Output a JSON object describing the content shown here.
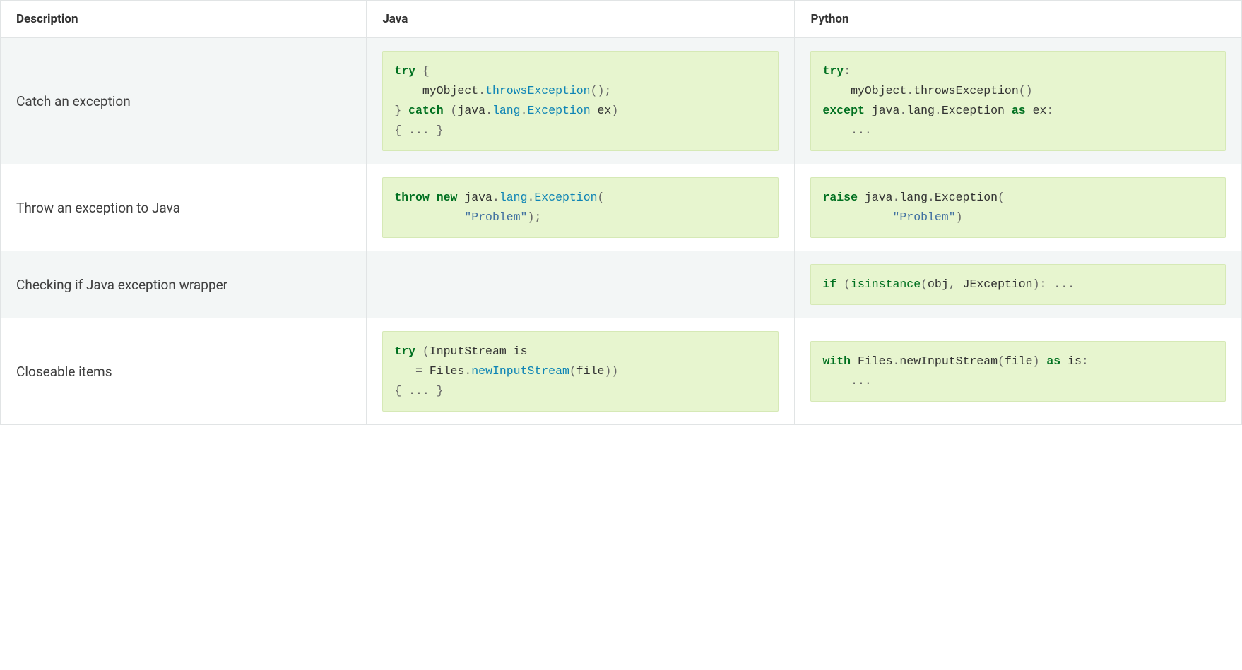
{
  "headers": {
    "description": "Description",
    "java": "Java",
    "python": "Python"
  },
  "rows": [
    {
      "desc": "Catch an exception",
      "java": [
        {
          "cls": "k",
          "t": "try"
        },
        {
          "cls": "p",
          "t": " {\n"
        },
        {
          "cls": "",
          "t": "    myObject"
        },
        {
          "cls": "p",
          "t": "."
        },
        {
          "cls": "nm",
          "t": "throwsException"
        },
        {
          "cls": "p",
          "t": "();\n"
        },
        {
          "cls": "p",
          "t": "} "
        },
        {
          "cls": "k",
          "t": "catch"
        },
        {
          "cls": "p",
          "t": " ("
        },
        {
          "cls": "",
          "t": "java"
        },
        {
          "cls": "p",
          "t": "."
        },
        {
          "cls": "nm",
          "t": "lang"
        },
        {
          "cls": "p",
          "t": "."
        },
        {
          "cls": "nm",
          "t": "Exception"
        },
        {
          "cls": "",
          "t": " ex"
        },
        {
          "cls": "p",
          "t": ")\n"
        },
        {
          "cls": "p",
          "t": "{ ... }"
        }
      ],
      "python": [
        {
          "cls": "k",
          "t": "try"
        },
        {
          "cls": "p",
          "t": ":\n"
        },
        {
          "cls": "",
          "t": "    myObject"
        },
        {
          "cls": "p",
          "t": "."
        },
        {
          "cls": "",
          "t": "throwsException"
        },
        {
          "cls": "p",
          "t": "()\n"
        },
        {
          "cls": "k",
          "t": "except"
        },
        {
          "cls": "",
          "t": " java"
        },
        {
          "cls": "p",
          "t": "."
        },
        {
          "cls": "",
          "t": "lang"
        },
        {
          "cls": "p",
          "t": "."
        },
        {
          "cls": "",
          "t": "Exception "
        },
        {
          "cls": "k",
          "t": "as"
        },
        {
          "cls": "",
          "t": " ex"
        },
        {
          "cls": "p",
          "t": ":\n"
        },
        {
          "cls": "p",
          "t": "    ..."
        }
      ]
    },
    {
      "desc": "Throw an exception to Java",
      "java": [
        {
          "cls": "k",
          "t": "throw"
        },
        {
          "cls": "",
          "t": " "
        },
        {
          "cls": "k",
          "t": "new"
        },
        {
          "cls": "",
          "t": " java"
        },
        {
          "cls": "p",
          "t": "."
        },
        {
          "cls": "nm",
          "t": "lang"
        },
        {
          "cls": "p",
          "t": "."
        },
        {
          "cls": "nm",
          "t": "Exception"
        },
        {
          "cls": "p",
          "t": "(\n"
        },
        {
          "cls": "",
          "t": "          "
        },
        {
          "cls": "s",
          "t": "\"Problem\""
        },
        {
          "cls": "p",
          "t": ");"
        }
      ],
      "python": [
        {
          "cls": "k",
          "t": "raise"
        },
        {
          "cls": "",
          "t": " java"
        },
        {
          "cls": "p",
          "t": "."
        },
        {
          "cls": "",
          "t": "lang"
        },
        {
          "cls": "p",
          "t": "."
        },
        {
          "cls": "",
          "t": "Exception"
        },
        {
          "cls": "p",
          "t": "(\n"
        },
        {
          "cls": "",
          "t": "          "
        },
        {
          "cls": "s",
          "t": "\"Problem\""
        },
        {
          "cls": "p",
          "t": ")"
        }
      ]
    },
    {
      "desc": "Checking if Java exception wrapper",
      "java": null,
      "python": [
        {
          "cls": "k",
          "t": "if"
        },
        {
          "cls": "p",
          "t": " ("
        },
        {
          "cls": "nb",
          "t": "isinstance"
        },
        {
          "cls": "p",
          "t": "("
        },
        {
          "cls": "",
          "t": "obj"
        },
        {
          "cls": "p",
          "t": ", "
        },
        {
          "cls": "",
          "t": "JException"
        },
        {
          "cls": "p",
          "t": "): ..."
        }
      ]
    },
    {
      "desc": "Closeable items",
      "java": [
        {
          "cls": "k",
          "t": "try"
        },
        {
          "cls": "p",
          "t": " ("
        },
        {
          "cls": "",
          "t": "InputStream is\n"
        },
        {
          "cls": "",
          "t": "   "
        },
        {
          "cls": "p",
          "t": "= "
        },
        {
          "cls": "",
          "t": "Files"
        },
        {
          "cls": "p",
          "t": "."
        },
        {
          "cls": "nm",
          "t": "newInputStream"
        },
        {
          "cls": "p",
          "t": "("
        },
        {
          "cls": "",
          "t": "file"
        },
        {
          "cls": "p",
          "t": "))\n"
        },
        {
          "cls": "p",
          "t": "{ ... }"
        }
      ],
      "python": [
        {
          "cls": "k",
          "t": "with"
        },
        {
          "cls": "",
          "t": " Files"
        },
        {
          "cls": "p",
          "t": "."
        },
        {
          "cls": "",
          "t": "newInputStream"
        },
        {
          "cls": "p",
          "t": "("
        },
        {
          "cls": "",
          "t": "file"
        },
        {
          "cls": "p",
          "t": ") "
        },
        {
          "cls": "k",
          "t": "as"
        },
        {
          "cls": "",
          "t": " is"
        },
        {
          "cls": "p",
          "t": ":\n"
        },
        {
          "cls": "p",
          "t": "    ..."
        }
      ]
    }
  ]
}
